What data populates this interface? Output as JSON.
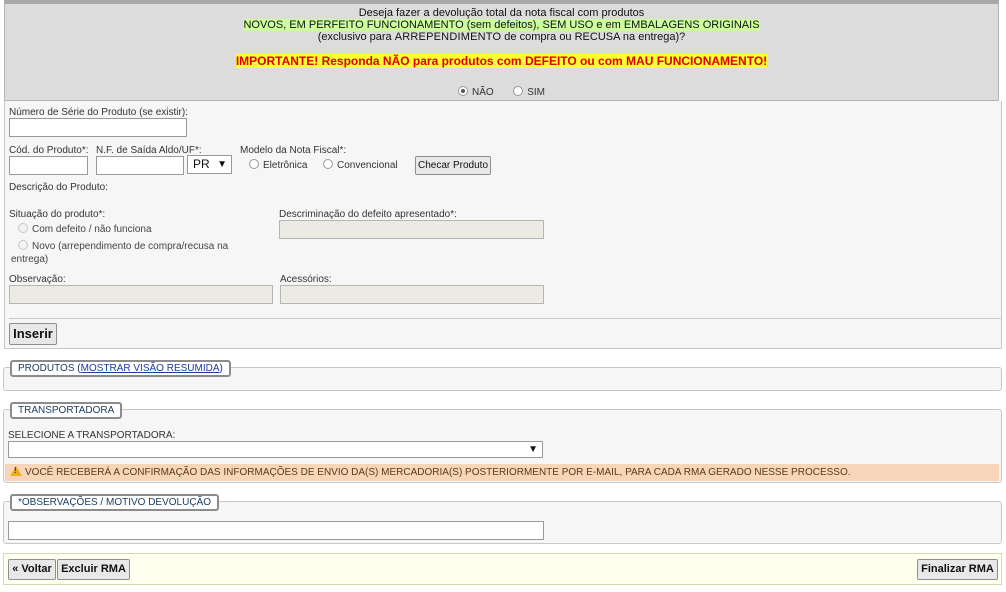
{
  "question": {
    "line1": "Deseja fazer a devolução total da nota fiscal com produtos",
    "line2": "NOVOS, EM PERFEITO FUNCIONAMENTO (sem defeitos), SEM USO e em EMBALAGENS ORIGINAIS",
    "line3_pre": "(exclusivo para ",
    "line3_b1": "ARREPENDIMENTO",
    "line3_mid": " de compra ou ",
    "line3_b2": "RECUSA",
    "line3_post": " na entrega)?",
    "important": "IMPORTANTE! Responda NÃO para produtos com DEFEITO ou com MAU FUNCIONAMENTO!",
    "option_no": "NÃO",
    "option_yes": "SIM",
    "selected": "NÃO"
  },
  "form": {
    "serial_label": "Número de Série do Produto (se existir):",
    "serial_value": "",
    "code_label": "Cód. do Produto*:",
    "code_value": "",
    "nf_label": "N.F. de Saída Aldo/UF*:",
    "nf_value": "",
    "uf_value": "PR",
    "model_label": "Modelo da Nota Fiscal*:",
    "model_opt1": "Eletrônica",
    "model_opt2": "Convencional",
    "check_button": "Checar Produto",
    "description_label": "Descrição do Produto:",
    "situation_label": "Situação do produto*:",
    "situation_opt1": "Com defeito / não funciona",
    "situation_opt2_a": "Novo (arrependimento de compra/recusa na",
    "situation_opt2_b": "entrega)",
    "defect_label": "Descriminação do defeito apresentado*:",
    "observation_label": "Observação:",
    "accessories_label": "Acessórios:",
    "insert_button": "Inserir"
  },
  "products": {
    "legend": "PRODUTOS",
    "link": "MOSTRAR VISÃO RESUMIDA"
  },
  "carrier": {
    "legend": "TRANSPORTADORA",
    "select_label": "SELECIONE A TRANSPORTADORA:",
    "selected_value": "",
    "warning": "VOCÊ RECEBERÁ A CONFIRMAÇÃO DAS INFORMAÇÕES DE ENVIO DA(S) MERCADORIA(S) POSTERIORMENTE POR E-MAIL, PARA CADA RMA GERADO NESSE PROCESSO."
  },
  "observations": {
    "legend": "*OBSERVAÇÕES / MOTIVO DEVOLUÇÃO",
    "value": ""
  },
  "actions": {
    "back": "« Voltar",
    "delete": "Excluir RMA",
    "finish": "Finalizar RMA"
  },
  "colors": {
    "green_highlight": "#ccff99",
    "yellow_highlight": "#ffff33",
    "important_text": "#e00000",
    "warning_bg": "#f8d5b8"
  }
}
